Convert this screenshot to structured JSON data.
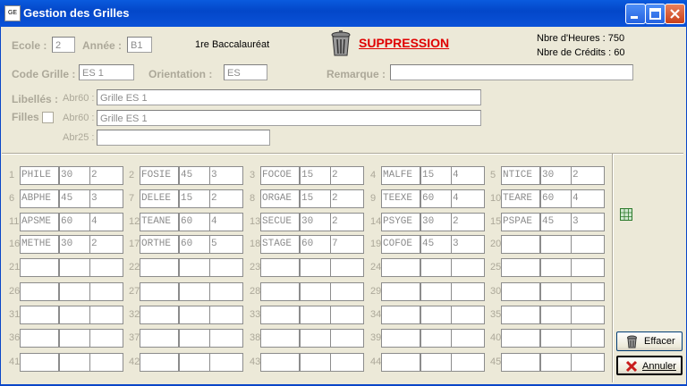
{
  "window": {
    "title": "Gestion des Grilles",
    "icon_label": "GE"
  },
  "header": {
    "ecole_label": "Ecole :",
    "ecole_value": "2",
    "annee_label": "Année :",
    "annee_value": "B1",
    "annee_desc": "1re Baccalauréat",
    "mode_label": "SUPPRESSION",
    "heures": "Nbre d'Heures : 750",
    "credits": "Nbre de Crédits : 60",
    "code_grille_label": "Code Grille :",
    "code_grille_value": "ES 1",
    "orientation_label": "Orientation :",
    "orientation_value": "ES",
    "remarque_label": "Remarque :",
    "remarque_value": "",
    "libelles_label": "Libellés :",
    "filles_label": "Filles",
    "abr60_label_1": "Abr60 :",
    "abr60_value_1": "Grille ES 1",
    "abr60_label_2": "Abr60 :",
    "abr60_value_2": "Grille ES 1",
    "abr25_label": "Abr25 :",
    "abr25_value": ""
  },
  "grid": [
    {
      "n": "1",
      "code": "PHILE",
      "h": "30",
      "c": "2"
    },
    {
      "n": "2",
      "code": "FOSIE",
      "h": "45",
      "c": "3"
    },
    {
      "n": "3",
      "code": "FOCOE",
      "h": "15",
      "c": "2"
    },
    {
      "n": "4",
      "code": "MALFE",
      "h": "15",
      "c": "4"
    },
    {
      "n": "5",
      "code": "NTICE",
      "h": "30",
      "c": "2"
    },
    {
      "n": "6",
      "code": "ABPHE",
      "h": "45",
      "c": "3"
    },
    {
      "n": "7",
      "code": "DELEE",
      "h": "15",
      "c": "2"
    },
    {
      "n": "8",
      "code": "ORGAE",
      "h": "15",
      "c": "2"
    },
    {
      "n": "9",
      "code": "TEEXE",
      "h": "60",
      "c": "4"
    },
    {
      "n": "10",
      "code": "TEARE",
      "h": "60",
      "c": "4"
    },
    {
      "n": "11",
      "code": "APSME",
      "h": "60",
      "c": "4"
    },
    {
      "n": "12",
      "code": "TEANE",
      "h": "60",
      "c": "4"
    },
    {
      "n": "13",
      "code": "SECUE",
      "h": "30",
      "c": "2"
    },
    {
      "n": "14",
      "code": "PSYGE",
      "h": "30",
      "c": "2"
    },
    {
      "n": "15",
      "code": "PSPAE",
      "h": "45",
      "c": "3"
    },
    {
      "n": "16",
      "code": "METHE",
      "h": "30",
      "c": "2"
    },
    {
      "n": "17",
      "code": "ORTHE",
      "h": "60",
      "c": "5"
    },
    {
      "n": "18",
      "code": "STAGE",
      "h": "60",
      "c": "7"
    },
    {
      "n": "19",
      "code": "COFOE",
      "h": "45",
      "c": "3"
    },
    {
      "n": "20",
      "code": "",
      "h": "",
      "c": ""
    },
    {
      "n": "21",
      "code": "",
      "h": "",
      "c": ""
    },
    {
      "n": "22",
      "code": "",
      "h": "",
      "c": ""
    },
    {
      "n": "23",
      "code": "",
      "h": "",
      "c": ""
    },
    {
      "n": "24",
      "code": "",
      "h": "",
      "c": ""
    },
    {
      "n": "25",
      "code": "",
      "h": "",
      "c": ""
    },
    {
      "n": "26",
      "code": "",
      "h": "",
      "c": ""
    },
    {
      "n": "27",
      "code": "",
      "h": "",
      "c": ""
    },
    {
      "n": "28",
      "code": "",
      "h": "",
      "c": ""
    },
    {
      "n": "29",
      "code": "",
      "h": "",
      "c": ""
    },
    {
      "n": "30",
      "code": "",
      "h": "",
      "c": ""
    },
    {
      "n": "31",
      "code": "",
      "h": "",
      "c": ""
    },
    {
      "n": "32",
      "code": "",
      "h": "",
      "c": ""
    },
    {
      "n": "33",
      "code": "",
      "h": "",
      "c": ""
    },
    {
      "n": "34",
      "code": "",
      "h": "",
      "c": ""
    },
    {
      "n": "35",
      "code": "",
      "h": "",
      "c": ""
    },
    {
      "n": "36",
      "code": "",
      "h": "",
      "c": ""
    },
    {
      "n": "37",
      "code": "",
      "h": "",
      "c": ""
    },
    {
      "n": "38",
      "code": "",
      "h": "",
      "c": ""
    },
    {
      "n": "39",
      "code": "",
      "h": "",
      "c": ""
    },
    {
      "n": "40",
      "code": "",
      "h": "",
      "c": ""
    },
    {
      "n": "41",
      "code": "",
      "h": "",
      "c": ""
    },
    {
      "n": "42",
      "code": "",
      "h": "",
      "c": ""
    },
    {
      "n": "43",
      "code": "",
      "h": "",
      "c": ""
    },
    {
      "n": "44",
      "code": "",
      "h": "",
      "c": ""
    },
    {
      "n": "45",
      "code": "",
      "h": "",
      "c": ""
    }
  ],
  "buttons": {
    "effacer": "Effacer",
    "annuler": "Annuler"
  },
  "icons": {
    "trash": "trash-icon",
    "grid": "grid-icon",
    "effacer": "eraser-icon",
    "annuler": "cancel-x-icon"
  },
  "colors": {
    "title_bar": "#0a5bde",
    "suppression": "#e00000",
    "background": "#ece9d8"
  }
}
